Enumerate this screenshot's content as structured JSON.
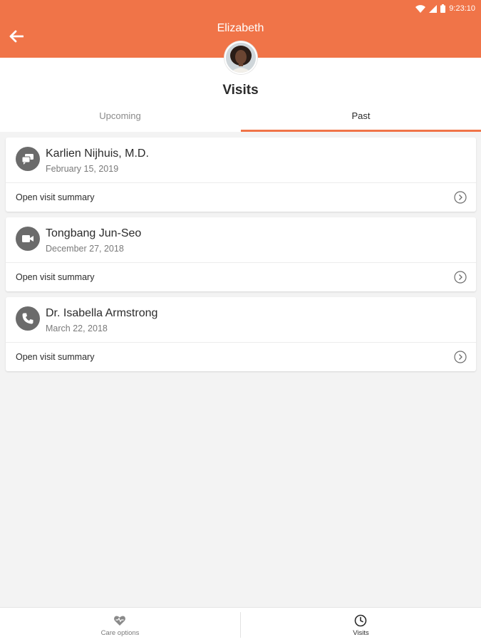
{
  "status_bar": {
    "time": "9:23:10"
  },
  "header": {
    "title": "Elizabeth",
    "back_icon": "arrow-left-icon",
    "accent_color": "#f07448"
  },
  "page": {
    "title": "Visits",
    "tabs": [
      {
        "label": "Upcoming",
        "selected": false
      },
      {
        "label": "Past",
        "selected": true
      }
    ]
  },
  "visits": [
    {
      "provider": "Karlien Nijhuis, M.D.",
      "date": "February 15, 2019",
      "type_icon": "chat-icon",
      "summary_label": "Open visit summary"
    },
    {
      "provider": "Tongbang Jun-Seo",
      "date": "December 27, 2018",
      "type_icon": "video-icon",
      "summary_label": "Open visit summary"
    },
    {
      "provider": "Dr. Isabella Armstrong",
      "date": "March 22, 2018",
      "type_icon": "phone-icon",
      "summary_label": "Open visit summary"
    }
  ],
  "bottom_nav": [
    {
      "label": "Care options",
      "icon": "heart-icon",
      "selected": false
    },
    {
      "label": "Visits",
      "icon": "clock-icon",
      "selected": true
    }
  ]
}
